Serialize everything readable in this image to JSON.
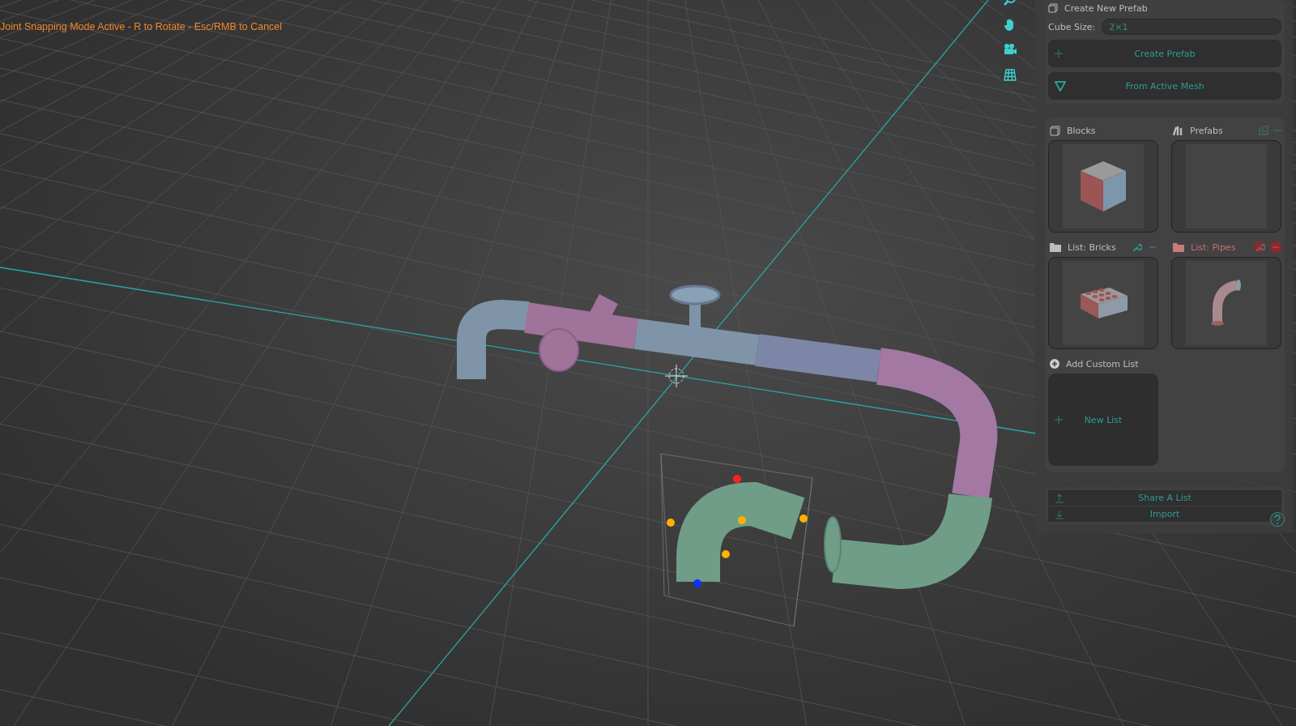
{
  "status_message": "Joint Snapping Mode Active - R to Rotate - Esc/RMB to Cancel",
  "create_section": {
    "title": "Create New Prefab",
    "cube_size": {
      "label": "Cube Size:",
      "value": "2×1"
    },
    "buttons": [
      {
        "label": "Create Prefab",
        "kind": "plus"
      },
      {
        "label": "From Active Mesh",
        "kind": "mesh"
      }
    ]
  },
  "libraries": [
    {
      "title": "Blocks",
      "kind": "cube"
    },
    {
      "title": "Prefabs",
      "kind": "empty"
    }
  ],
  "lists": [
    {
      "title": "List: Bricks",
      "selected": false,
      "kind": "brick"
    },
    {
      "title": "List: Pipes",
      "selected": true,
      "kind": "pipe"
    }
  ],
  "add_list": {
    "title": "Add Custom List",
    "button": "New List"
  },
  "share_buttons": [
    {
      "label": "Share A List",
      "kind": "upload"
    },
    {
      "label": "Import",
      "kind": "download"
    }
  ]
}
